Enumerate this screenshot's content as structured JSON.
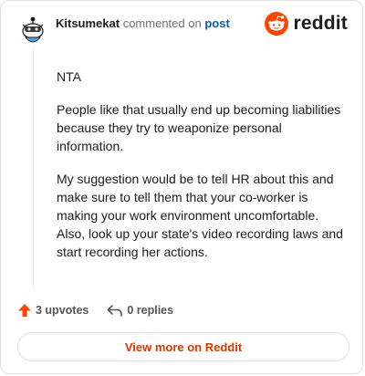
{
  "header": {
    "username": "Kitsumekat",
    "action_text": "commented on",
    "post_link": "post",
    "brand_word": "reddit",
    "avatar_icon": "snoo-avatar-icon",
    "brand_icon": "reddit-logo-icon"
  },
  "comment": {
    "paragraphs": [
      "NTA",
      "People like that usually end up becoming liabilities because they try to weaponize personal information.",
      "My suggestion would be to tell HR about this and make sure to tell them that your co-worker is making your work environment uncomfortable. Also, look up your state's video recording laws and start recording her actions."
    ]
  },
  "actions": {
    "upvotes": "3 upvotes",
    "replies": "0 replies",
    "upvote_icon": "upvote-arrow-icon",
    "reply_icon": "reply-arrow-icon"
  },
  "footer": {
    "view_more": "View more on Reddit"
  },
  "colors": {
    "accent": "#ff4500",
    "link": "#0b5ba8",
    "cta": "#d93a00"
  }
}
